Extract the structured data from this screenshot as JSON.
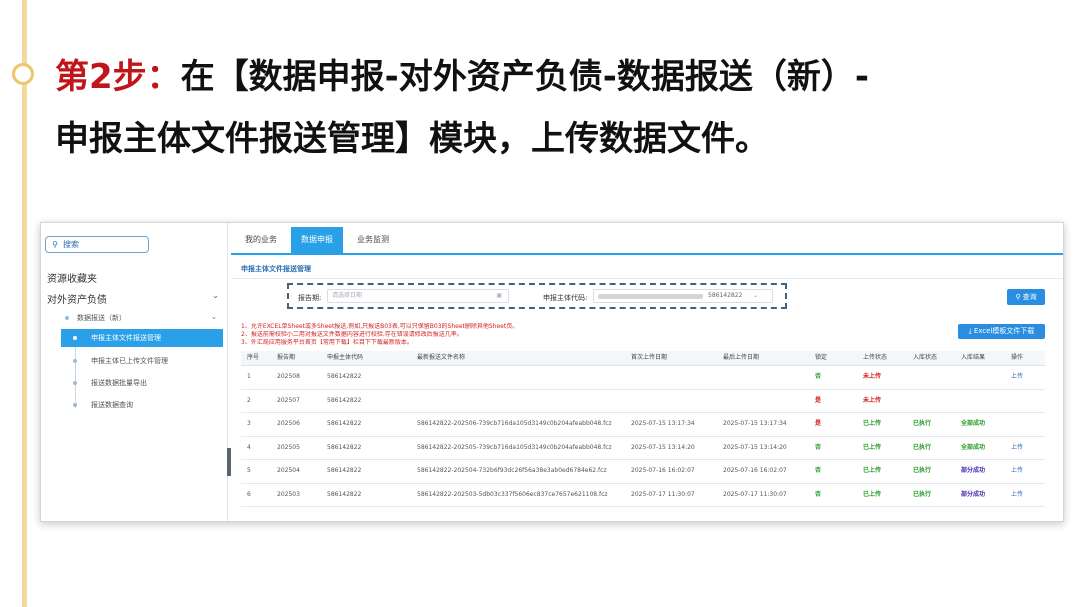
{
  "slide": {
    "step_label": "第2步：",
    "title_line1": "在【数据申报-对外资产负债-数据报送（新）-",
    "title_line2": "申报主体文件报送管理】模块，上传数据文件。"
  },
  "sidebar": {
    "search_label": "搜索",
    "favorites": "资源收藏夹",
    "group": "对外资产负债",
    "subgroup": "数据报送（新）",
    "items": [
      {
        "label": "申报主体文件报送管理"
      },
      {
        "label": "申报主体已上传文件管理"
      },
      {
        "label": "报送数据批量导出"
      },
      {
        "label": "报送数据查询"
      }
    ]
  },
  "tabs": [
    {
      "label": "我的业务"
    },
    {
      "label": "数据申报"
    },
    {
      "label": "业务监测"
    }
  ],
  "page": {
    "subheader": "申报主体文件报送管理"
  },
  "filters": {
    "period_label": "报告期:",
    "period_placeholder": "请选择日期",
    "entity_label": "申报主体代码:",
    "entity_code": "586142822"
  },
  "buttons": {
    "query": "查询",
    "download": "Excel模板文件下载"
  },
  "notes": [
    "1、允许EXCEL单Sheet或多Sheet报送,例如,只报送B03表,可以只保留B03的Sheet删除其他Sheet页。",
    "2、报送前需校验小二用对报送文件数据内容进行校验,存在错误请修改后报送几率。",
    "3、外汇局应用服务平台首页【常用下载】栏目下下载最新版本。"
  ],
  "table": {
    "headers": [
      "序号",
      "报告期",
      "申报主体代码",
      "最新报送文件名称",
      "首次上传日期",
      "最后上传日期",
      "锁定",
      "上传状态",
      "入库状态",
      "入库结果",
      "操作"
    ],
    "rows": [
      {
        "no": "1",
        "period": "202508",
        "code": "586142822",
        "file": "",
        "first": "",
        "last": "",
        "locked": "否",
        "upload": "未上传",
        "db": "",
        "result": "",
        "action": "上传"
      },
      {
        "no": "2",
        "period": "202507",
        "code": "586142822",
        "file": "",
        "first": "",
        "last": "",
        "locked": "是",
        "upload": "未上传",
        "db": "",
        "result": "",
        "action": ""
      },
      {
        "no": "3",
        "period": "202506",
        "code": "586142822",
        "file": "586142822-202506-739cb716da105d3149c0b204afeabb048.fcz",
        "first": "2025-07-15 13:17:34",
        "last": "2025-07-15 13:17:34",
        "locked": "是",
        "upload": "已上传",
        "db": "已执行",
        "result": "全部成功",
        "action": ""
      },
      {
        "no": "4",
        "period": "202505",
        "code": "586142822",
        "file": "586142822-202505-739cb716da105d3149c0b204afeabb048.fcz",
        "first": "2025-07-15 13:14:20",
        "last": "2025-07-15 13:14:20",
        "locked": "否",
        "upload": "已上传",
        "db": "已执行",
        "result": "全部成功",
        "action": "上传"
      },
      {
        "no": "5",
        "period": "202504",
        "code": "586142822",
        "file": "586142822-202504-732b6f93dc26f56a38e3ab0ed6784e62.fcz",
        "first": "2025-07-16 16:02:07",
        "last": "2025-07-16 16:02:07",
        "locked": "否",
        "upload": "已上传",
        "db": "已执行",
        "result": "部分成功",
        "action": "上传"
      },
      {
        "no": "6",
        "period": "202503",
        "code": "586142822",
        "file": "586142822-202503-5db03c337f5606ec837ce7657e621108.fcz",
        "first": "2025-07-17 11:30:07",
        "last": "2025-07-17 11:30:07",
        "locked": "否",
        "upload": "已上传",
        "db": "已执行",
        "result": "部分成功",
        "action": "上传"
      }
    ]
  },
  "colors": {
    "accent": "#2aa0e8",
    "step_red": "#c0161b",
    "status_green": "#2a9a2a",
    "status_red": "#d42020"
  }
}
